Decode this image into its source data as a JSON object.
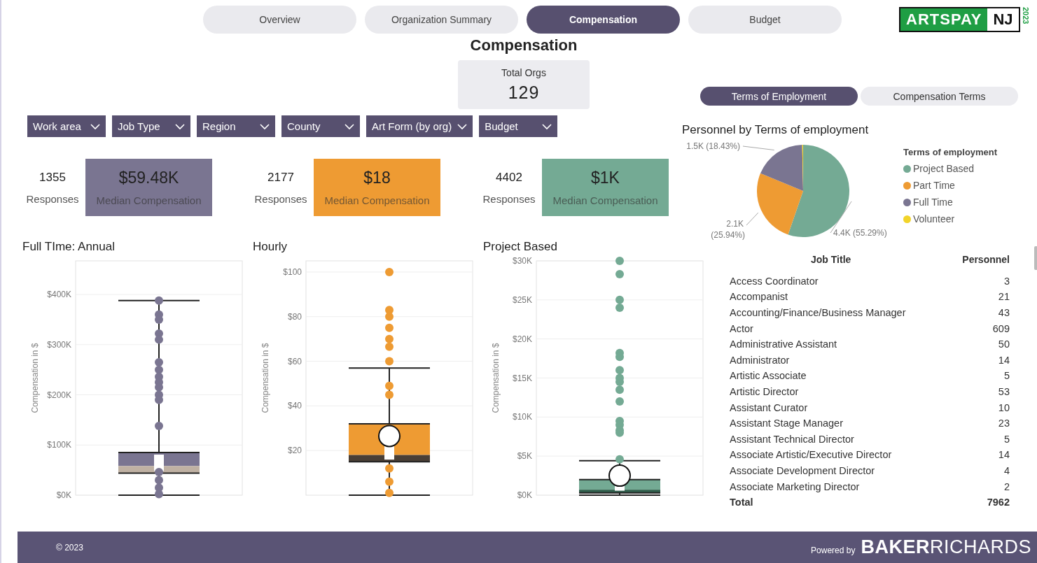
{
  "nav_tabs": [
    {
      "label": "Overview",
      "selected": false
    },
    {
      "label": "Organization Summary",
      "selected": false
    },
    {
      "label": "Compensation",
      "selected": true
    },
    {
      "label": "Budget",
      "selected": false
    }
  ],
  "logo": {
    "name": "ARTSPAY",
    "region": "NJ",
    "year": "2023"
  },
  "page_title": "Compensation",
  "total_orgs": {
    "label": "Total Orgs",
    "value": "129"
  },
  "filters": [
    "Work area",
    "Job Type",
    "Region",
    "County",
    "Art Form (by org)",
    "Budget"
  ],
  "kpis": [
    {
      "count": "1355",
      "count_label": "Responses",
      "value": "$59.48K",
      "value_label": "Median Compensation",
      "color": "#7a7591"
    },
    {
      "count": "2177",
      "count_label": "Responses",
      "value": "$18",
      "value_label": "Median Compensation",
      "color": "#ee9b33"
    },
    {
      "count": "4402",
      "count_label": "Responses",
      "value": "$1K",
      "value_label": "Median Compensation",
      "color": "#74aa94"
    }
  ],
  "box_charts": [
    {
      "title": "Full TIme: Annual",
      "y_axis_title": "Compensation in $",
      "y_tick_labels": [
        "$400K",
        "$300K",
        "$200K",
        "$100K",
        "$0K"
      ],
      "color": "#7a7591"
    },
    {
      "title": "Hourly",
      "y_axis_title": "Compensation in $",
      "y_tick_labels": [
        "$100",
        "$80",
        "$60",
        "$40",
        "$20"
      ],
      "color": "#ee9b33"
    },
    {
      "title": "Project Based",
      "y_axis_title": "Compensation in $",
      "y_tick_labels": [
        "$30K",
        "$25K",
        "$20K",
        "$15K",
        "$10K",
        "$5K",
        "$0K"
      ],
      "color": "#74aa94"
    }
  ],
  "view_tabs": [
    {
      "label": "Terms of Employment",
      "selected": true
    },
    {
      "label": "Compensation Terms",
      "selected": false
    }
  ],
  "pie": {
    "title": "Personnel by Terms of employment",
    "legend_title": "Terms of employment",
    "chart_data": {
      "type": "pie",
      "categories": [
        "Project Based",
        "Part Time",
        "Full Time",
        "Volunteer"
      ],
      "values": [
        4402,
        2066,
        1467,
        27
      ],
      "colors": [
        "#74aa94",
        "#ee9b33",
        "#7a7591",
        "#f2d42a"
      ],
      "value_labels": [
        "4.4K (55.29%)",
        "2.1K (25.94%)",
        "1.5K (18.43%)",
        null
      ]
    }
  },
  "table": {
    "columns": [
      "Job Title",
      "Personnel"
    ],
    "rows": [
      [
        "Access Coordinator",
        "3"
      ],
      [
        "Accompanist",
        "21"
      ],
      [
        "Accounting/Finance/Business Manager",
        "43"
      ],
      [
        "Actor",
        "609"
      ],
      [
        "Administrative Assistant",
        "50"
      ],
      [
        "Administrator",
        "14"
      ],
      [
        "Artistic Associate",
        "5"
      ],
      [
        "Artistic Director",
        "53"
      ],
      [
        "Assistant Curator",
        "10"
      ],
      [
        "Assistant Stage Manager",
        "23"
      ],
      [
        "Assistant Technical Director",
        "5"
      ],
      [
        "Associate Artistic/Executive Director",
        "14"
      ],
      [
        "Associate Development Director",
        "4"
      ],
      [
        "Associate Marketing Director",
        "2"
      ]
    ],
    "total": [
      "Total",
      "7962"
    ]
  },
  "footer": {
    "copyright": "© 2023",
    "powered_by": "Powered by",
    "brand": "**BAKER**RICHARDS"
  }
}
